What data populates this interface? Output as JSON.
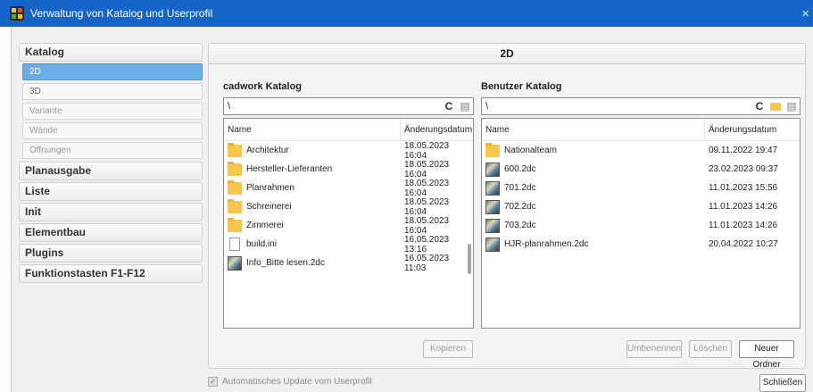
{
  "window": {
    "title": "Verwaltung von Katalog und Userprofil",
    "close_glyph": "×"
  },
  "nav": {
    "categories": [
      {
        "label": "Katalog",
        "subs": [
          {
            "label": "2D",
            "state": "active"
          },
          {
            "label": "3D",
            "state": "normal"
          },
          {
            "label": "Variante",
            "state": "disabled"
          },
          {
            "label": "Wände",
            "state": "disabled"
          },
          {
            "label": "Öffnungen",
            "state": "disabled"
          }
        ]
      },
      {
        "label": "Planausgabe"
      },
      {
        "label": "Liste"
      },
      {
        "label": "Init"
      },
      {
        "label": "Elementbau"
      },
      {
        "label": "Plugins"
      },
      {
        "label": "Funktionstasten F1-F12"
      }
    ]
  },
  "main": {
    "header": "2D",
    "left": {
      "title": "cadwork Katalog",
      "path": "\\",
      "refresh_icon": "refresh-icon",
      "columns": {
        "name": "Name",
        "date": "Änderungsdatum"
      },
      "rows": [
        {
          "name": "Architektur",
          "date": "18.05.2023 16:04",
          "icon": "folder-icon"
        },
        {
          "name": "Hersteller-Lieferanten",
          "date": "18.05.2023 16:04",
          "icon": "folder-icon"
        },
        {
          "name": "Planrahmen",
          "date": "18.05.2023 16:04",
          "icon": "folder-icon"
        },
        {
          "name": "Schreinerei",
          "date": "18.05.2023 16:04",
          "icon": "folder-icon"
        },
        {
          "name": "Zimmerei",
          "date": "18.05.2023 16:04",
          "icon": "folder-icon"
        },
        {
          "name": "build.ini",
          "date": "16.05.2023 13:16",
          "icon": "file-icon"
        },
        {
          "name": "Info_Bitte lesen.2dc",
          "date": "16.05.2023 11:03",
          "icon": "2dc-file-icon"
        }
      ],
      "copy_button": "Kopieren"
    },
    "right": {
      "title": "Benutzer Katalog",
      "path": "\\",
      "columns": {
        "name": "Name",
        "date": "Änderungsdatum"
      },
      "rows": [
        {
          "name": "Nationalteam",
          "date": "09.11.2022 19:47",
          "icon": "folder-icon"
        },
        {
          "name": "600.2dc",
          "date": "23.02.2023 09:37",
          "icon": "2dc-file-icon"
        },
        {
          "name": "701.2dc",
          "date": "11.01.2023 15:56",
          "icon": "2dc-file-icon"
        },
        {
          "name": "702.2dc",
          "date": "11.01.2023 14:26",
          "icon": "2dc-file-icon"
        },
        {
          "name": "703.2dc",
          "date": "11.01.2023 14:26",
          "icon": "2dc-file-icon"
        },
        {
          "name": "HJR-planrahmen.2dc",
          "date": "20.04.2022 10:27",
          "icon": "2dc-file-icon"
        }
      ],
      "rename_button": "Umbenennen",
      "delete_button": "Löschen",
      "new_folder_button": "Neuer Ordner"
    }
  },
  "footer": {
    "auto_update_label": "Automatisches Update vom Userprofil",
    "auto_update_checked": true,
    "close_button": "Schließen"
  }
}
